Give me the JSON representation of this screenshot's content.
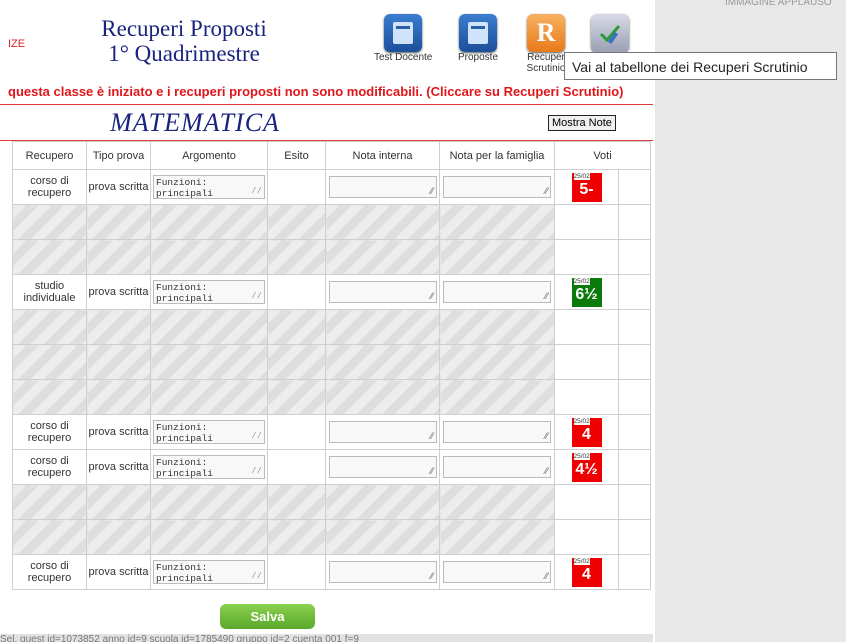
{
  "header": {
    "frag_left": "IZE",
    "title_line1": "Recuperi Proposti",
    "title_line2": "1° Quadrimestre",
    "top_right_frag": "IMMAGINE APPLAUSO"
  },
  "toolbar": {
    "test_docente": "Test Docente",
    "proposte": "Proposte",
    "recuperi_l1": "Recuper",
    "recuperi_l2": "Scrutinio",
    "recuperi_icon_letter": "R"
  },
  "tooltip": "Vai al tabellone dei Recuperi Scrutinio",
  "warning": "questa classe è iniziato e i recuperi proposti non sono modificabili. (Cliccare su Recuperi Scrutinio)",
  "subject": "MATEMATICA",
  "mostra_note": "Mostra Note",
  "columns": [
    "Recupero",
    "Tipo prova",
    "Argomento",
    "Esito",
    "Nota interna",
    "Nota per la famiglia",
    "Voti"
  ],
  "rows": [
    {
      "recupero": "corso di recupero",
      "tipo": "prova scritta",
      "argomento": "Funzioni: principali",
      "date": "25/02",
      "voto": "5-",
      "color": "red"
    },
    {
      "empty": true
    },
    {
      "empty": true
    },
    {
      "recupero": "studio individuale",
      "tipo": "prova scritta",
      "argomento": "Funzioni: principali",
      "date": "25/02",
      "voto": "6½",
      "color": "green"
    },
    {
      "empty": true
    },
    {
      "empty": true
    },
    {
      "empty": true
    },
    {
      "recupero": "corso di recupero",
      "tipo": "prova scritta",
      "argomento": "Funzioni: principali",
      "date": "25/02",
      "voto": "4",
      "color": "red"
    },
    {
      "recupero": "corso di recupero",
      "tipo": "prova scritta",
      "argomento": "Funzioni: principali",
      "date": "25/02",
      "voto": "4½",
      "color": "red"
    },
    {
      "empty": true
    },
    {
      "empty": true
    },
    {
      "recupero": "corso di recupero",
      "tipo": "prova scritta",
      "argomento": "Funzioni: principali",
      "date": "25/02",
      "voto": "4",
      "color": "red"
    }
  ],
  "empty_vote": "-",
  "salva": "Salva",
  "footer": "Sel. guest id=1073852 anno id=9 scuola id=1785490 gruppo id=2 cuenta 001 f=9"
}
